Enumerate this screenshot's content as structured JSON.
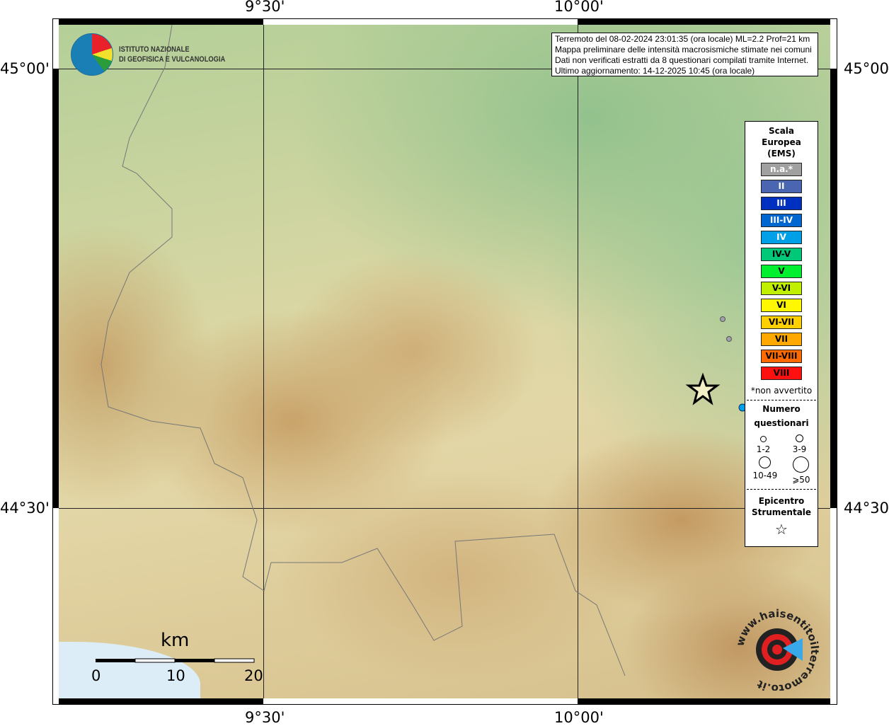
{
  "axes": {
    "lon_labels": [
      "9°30'",
      "10°00'"
    ],
    "lat_labels": [
      "45°00'",
      "44°30'"
    ]
  },
  "header": {
    "lines": [
      "Terremoto del 08-02-2024 23:01:35 (ora locale) ML=2.2 Prof=21 km",
      "Mappa preliminare delle intensità macrosismiche stimate nei comuni",
      "Dati non verificati estratti da 8 questionari compilati tramite Internet.",
      "Ultimo aggiornamento: 14-12-2025 10:45 (ora locale)"
    ]
  },
  "logo": {
    "line1": "ISTITUTO NAZIONALE",
    "line2": "DI GEOFISICA E VULCANOLOGIA"
  },
  "legend": {
    "title": [
      "Scala",
      "Europea",
      "(EMS)"
    ],
    "scale": [
      {
        "label": "n.a.*",
        "color": "#a0a0a0",
        "text": "#ffffff"
      },
      {
        "label": "II",
        "color": "#4a66b0",
        "text": "#ffffff"
      },
      {
        "label": "III",
        "color": "#0030c0",
        "text": "#ffffff"
      },
      {
        "label": "III-IV",
        "color": "#0066d0",
        "text": "#ffffff"
      },
      {
        "label": "IV",
        "color": "#00a0e8",
        "text": "#ffffff"
      },
      {
        "label": "IV-V",
        "color": "#00c878",
        "text": "#000000"
      },
      {
        "label": "V",
        "color": "#00f030",
        "text": "#000000"
      },
      {
        "label": "V-VI",
        "color": "#c0f000",
        "text": "#000000"
      },
      {
        "label": "VI",
        "color": "#fff800",
        "text": "#000000"
      },
      {
        "label": "VI-VII",
        "color": "#ffd000",
        "text": "#000000"
      },
      {
        "label": "VII",
        "color": "#ffa800",
        "text": "#000000"
      },
      {
        "label": "VII-VIII",
        "color": "#ff6a00",
        "text": "#000000"
      },
      {
        "label": "VIII",
        "color": "#ff1010",
        "text": "#000000"
      }
    ],
    "note": "*non avvertito",
    "count_title": [
      "Numero",
      "questionari"
    ],
    "counts": [
      "1-2",
      "3-9",
      "10-49",
      "⩾50"
    ],
    "epicenter_title": [
      "Epicentro",
      "Strumentale"
    ]
  },
  "scalebar": {
    "unit": "km",
    "ticks": [
      "0",
      "10",
      "20"
    ]
  },
  "points": [
    {
      "intensity": "n.a.*",
      "color": "#a0a0a0"
    },
    {
      "intensity": "n.a.*",
      "color": "#a0a0a0"
    },
    {
      "intensity": "IV",
      "color": "#00a0e8"
    }
  ],
  "watermark": {
    "text": "www.haisentitoilterremoto.it"
  }
}
